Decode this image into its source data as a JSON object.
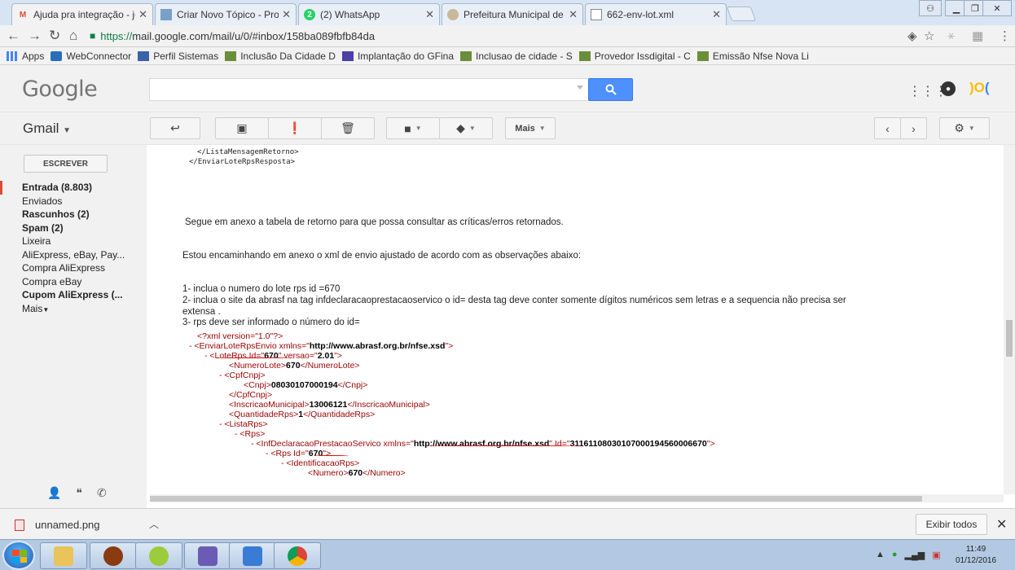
{
  "browser": {
    "tabs": [
      {
        "title": "Ajuda pra integração - jo",
        "icon": "gmail-icon",
        "active": true
      },
      {
        "title": "Criar Novo Tópico - Proje",
        "icon": "site-icon",
        "active": false
      },
      {
        "title": "(2) WhatsApp",
        "icon": "whatsapp-icon",
        "active": false
      },
      {
        "title": "Prefeitura Municipal de S",
        "icon": "site-icon",
        "active": false
      },
      {
        "title": "662-env-lot.xml",
        "icon": "file-icon",
        "active": false
      }
    ],
    "url_scheme": "https://",
    "url_rest": "mail.google.com/mail/u/0/#inbox/158ba089fbfb84da",
    "bookmarks": [
      {
        "label": "Apps",
        "icon": "apps-icon"
      },
      {
        "label": "WebConnector",
        "icon": "site-icon"
      },
      {
        "label": "Perfil Sistemas",
        "icon": "site-icon"
      },
      {
        "label": "Inclusão Da Cidade D",
        "icon": "folder-icon"
      },
      {
        "label": "Implantação do GFina",
        "icon": "site-icon"
      },
      {
        "label": "Inclusao de cidade - S",
        "icon": "folder-icon"
      },
      {
        "label": "Provedor Issdigital - C",
        "icon": "folder-icon"
      },
      {
        "label": "Emissão Nfse Nova Li",
        "icon": "folder-icon"
      }
    ]
  },
  "gmail": {
    "logo": "Google",
    "app_label": "Gmail",
    "more_label": "Mais",
    "compose": "ESCREVER",
    "nav": [
      {
        "label": "Entrada (8.803)",
        "bold": true,
        "active": true
      },
      {
        "label": "Enviados",
        "bold": false
      },
      {
        "label": "Rascunhos (2)",
        "bold": true
      },
      {
        "label": "Spam (2)",
        "bold": true
      },
      {
        "label": "Lixeira",
        "bold": false
      },
      {
        "label": "AliExpress, eBay, Pay...",
        "bold": false
      },
      {
        "label": "Compra AliExpress",
        "bold": false
      },
      {
        "label": "Compra eBay",
        "bold": false
      },
      {
        "label": "Cupom AliExpress (...",
        "bold": true
      },
      {
        "label": "Mais",
        "bold": false
      }
    ]
  },
  "message": {
    "xml_top_1": "</ListaMensagemRetorno>",
    "xml_top_2": "</EnviarLoteRpsResposta>",
    "para1": "Segue em anexo a tabela de retorno para que possa consultar as críticas/erros retornados.",
    "para2": "Estou encaminhando em anexo o xml de envio ajustado de acordo com as observações abaixo:",
    "item1": "1- inclua o numero do lote rps id =670",
    "item2": "2- inclua o site da abrasf na tag infdeclaracaoprestacaoservico  o id= desta tag deve conter somente dígitos numéricos sem letras e a sequencia não precisa ser",
    "item2b": "extensa .",
    "item3": "3- rps deve ser informado o número do id="
  },
  "xml_lines": {
    "l1": "<?xml version=\"1.0\"?>",
    "l2_tag": "<EnviarLoteRpsEnvio xmlns=\"",
    "l2_val": "http://www.abrasf.org.br/nfse.xsd",
    "l2_end": "\">",
    "l3_tag": "<LoteRps Id=\"",
    "l3_id": "670",
    "l3_mid": "\" versao=\"",
    "l3_ver": "2.01",
    "l3_end": "\">",
    "l4_tag": "<NumeroLote>",
    "l4_val": "670",
    "l4_end": "</NumeroLote>",
    "l5": "<CpfCnpj>",
    "l6_tag": "<Cnpj>",
    "l6_val": "08030107000194",
    "l6_end": "</Cnpj>",
    "l7": "</CpfCnpj>",
    "l8_tag": "<InscricaoMunicipal>",
    "l8_val": "13006121",
    "l8_end": "</InscricaoMunicipal>",
    "l9_tag": "<QuantidadeRps>",
    "l9_val": "1",
    "l9_end": "</QuantidadeRps>",
    "l10": "<ListaRps>",
    "l11": "<Rps>",
    "l12_tag": "<InfDeclaracaoPrestacaoServico xmlns=\"",
    "l12_val": "http://www.abrasf.org.br/nfse.xsd",
    "l12_mid": "\" Id=\"",
    "l12_id": "31161108030107000194560006670",
    "l12_end": "\">",
    "l13_tag": "<Rps Id=\"",
    "l13_id": "670",
    "l13_end": "\">",
    "l14": "<IdentificacaoRps>",
    "l15_tag": "<Numero>",
    "l15_val": "670",
    "l15_end": "</Numero>"
  },
  "download": {
    "file": "unnamed.png",
    "show_all": "Exibir todos"
  },
  "taskbar": {
    "time": "11:49",
    "date": "01/12/2016"
  },
  "colors": {
    "gmail_red": "#dd4b39",
    "search_blue": "#4d90fe",
    "url_green": "#0b8043",
    "xml_tag": "#990000",
    "annotation_red": "#dd0000"
  }
}
